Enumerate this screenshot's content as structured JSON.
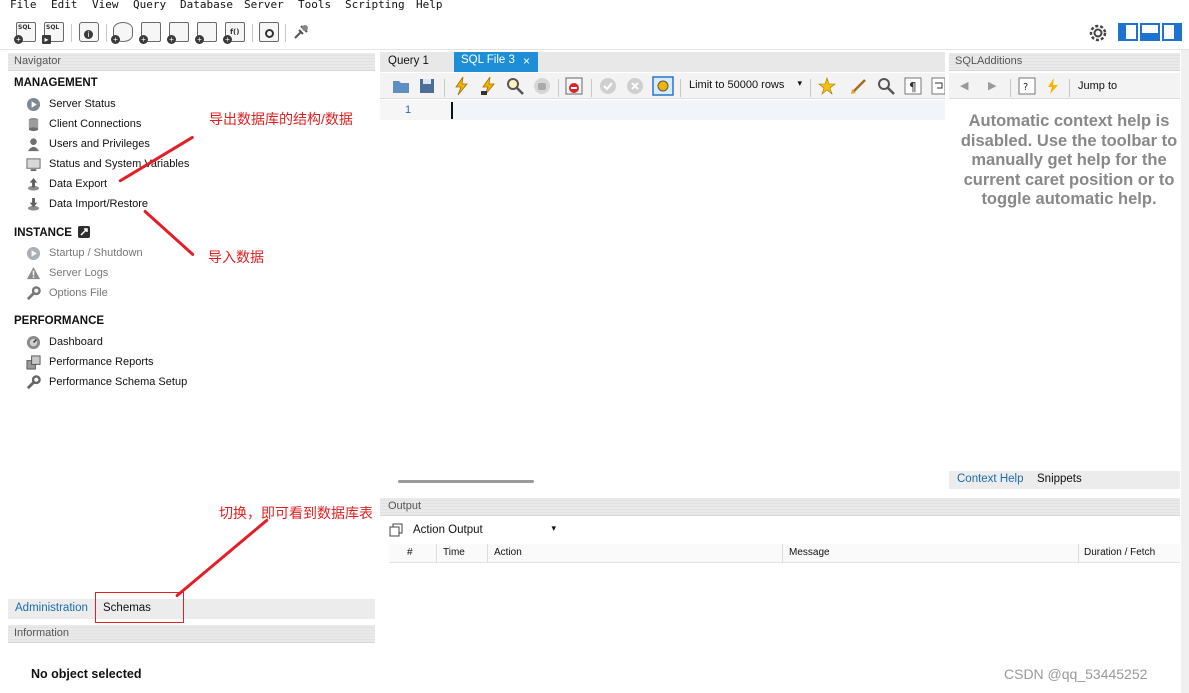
{
  "menu": [
    "File",
    "Edit",
    "View",
    "Query",
    "Database",
    "Server",
    "Tools",
    "Scripting",
    "Help"
  ],
  "toolbar": {
    "buttons": [
      {
        "name": "new-sql-tab-button",
        "tag": "SQL"
      },
      {
        "name": "open-sql-file-button",
        "tag": "SQL"
      },
      {
        "name": "inspector-button",
        "tag": ""
      },
      {
        "name": "create-schema-button",
        "tag": ""
      },
      {
        "name": "create-table-button",
        "tag": ""
      },
      {
        "name": "create-view-button",
        "tag": ""
      },
      {
        "name": "create-procedure-button",
        "tag": ""
      },
      {
        "name": "create-function-button",
        "tag": "f()"
      },
      {
        "name": "search-table-data-button",
        "tag": ""
      },
      {
        "name": "reconnect-button",
        "tag": ""
      }
    ]
  },
  "navigator": {
    "header": "Navigator",
    "management": {
      "title": "MANAGEMENT",
      "items": [
        "Server Status",
        "Client Connections",
        "Users and Privileges",
        "Status and System Variables",
        "Data Export",
        "Data Import/Restore"
      ]
    },
    "instance": {
      "title": "INSTANCE",
      "items": [
        "Startup / Shutdown",
        "Server Logs",
        "Options File"
      ]
    },
    "performance": {
      "title": "PERFORMANCE",
      "items": [
        "Dashboard",
        "Performance Reports",
        "Performance Schema Setup"
      ]
    },
    "bottom_tabs": {
      "administration": "Administration",
      "schemas": "Schemas"
    }
  },
  "information": {
    "header": "Information",
    "message": "No object selected"
  },
  "editor": {
    "tabs": [
      {
        "label": "Query 1",
        "active": false
      },
      {
        "label": "SQL File 3",
        "active": true,
        "close": "×"
      }
    ],
    "limit_select": "Limit to 50000 rows",
    "line_numbers": [
      "1"
    ]
  },
  "sql_additions": {
    "header": "SQLAdditions",
    "jump_to": "Jump to",
    "help_text": [
      "Automatic context help is",
      "disabled. Use the toolbar to",
      "manually get help for the",
      "current caret position or to",
      "toggle automatic help."
    ],
    "tabs": {
      "context_help": "Context Help",
      "snippets": "Snippets"
    }
  },
  "output": {
    "header": "Output",
    "select": "Action Output",
    "columns": [
      "#",
      "Time",
      "Action",
      "Message",
      "Duration / Fetch"
    ]
  },
  "annotations": {
    "export": "导出数据库的结构/数据",
    "import": "导入数据",
    "switch": "切换，即可看到数据库表"
  },
  "watermark": "CSDN @qq_53445252",
  "colors": {
    "annotation": "#e41e26",
    "active_tab": "#1e8fd6",
    "link_tab": "#1c6bb0"
  }
}
